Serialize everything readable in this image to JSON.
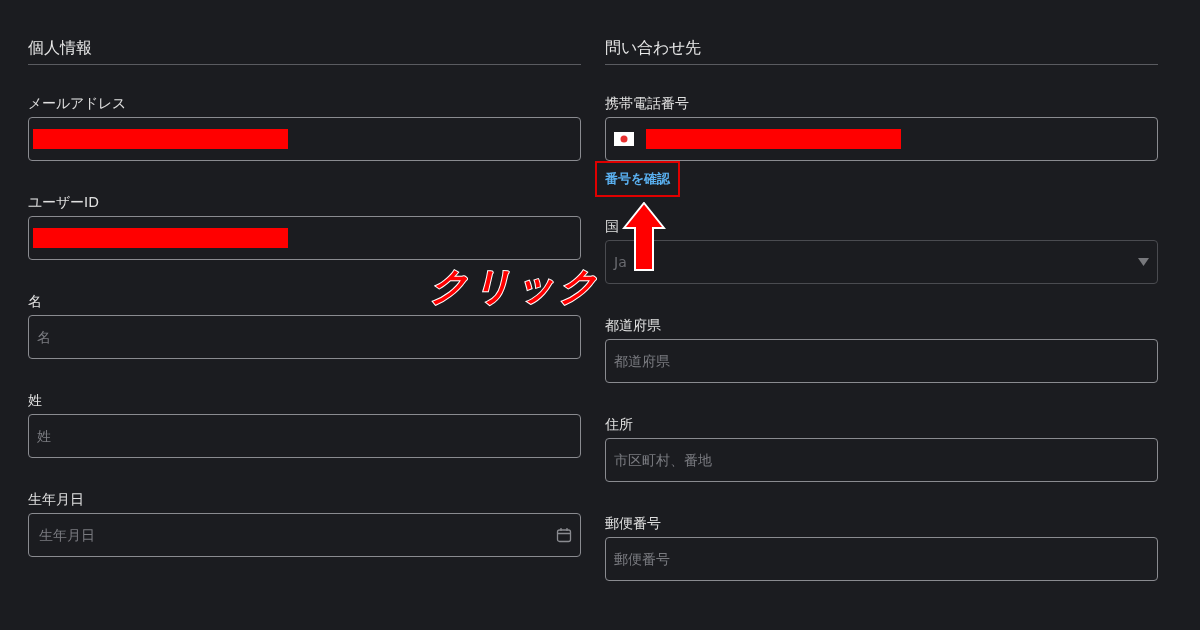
{
  "sections": [
    {
      "title": "個人情報",
      "fields": [
        {
          "label": "メールアドレス",
          "kind": "redacted"
        },
        {
          "label": "ユーザーID",
          "kind": "redacted"
        },
        {
          "label": "名",
          "kind": "text",
          "placeholder": "名"
        },
        {
          "label": "姓",
          "kind": "text",
          "placeholder": "姓"
        },
        {
          "label": "生年月日",
          "kind": "date",
          "placeholder": "生年月日"
        }
      ]
    },
    {
      "title": "問い合わせ先",
      "fields": [
        {
          "label": "携帯電話番号",
          "kind": "phone",
          "link": "番号を確認"
        },
        {
          "label": "国",
          "kind": "select",
          "value": "Ja"
        },
        {
          "label": "都道府県",
          "kind": "text",
          "placeholder": "都道府県"
        },
        {
          "label": "住所",
          "kind": "text",
          "placeholder": "市区町村、番地"
        },
        {
          "label": "郵便番号",
          "kind": "text",
          "placeholder": "郵便番号"
        }
      ]
    }
  ],
  "annotation": {
    "text": "クリック"
  }
}
